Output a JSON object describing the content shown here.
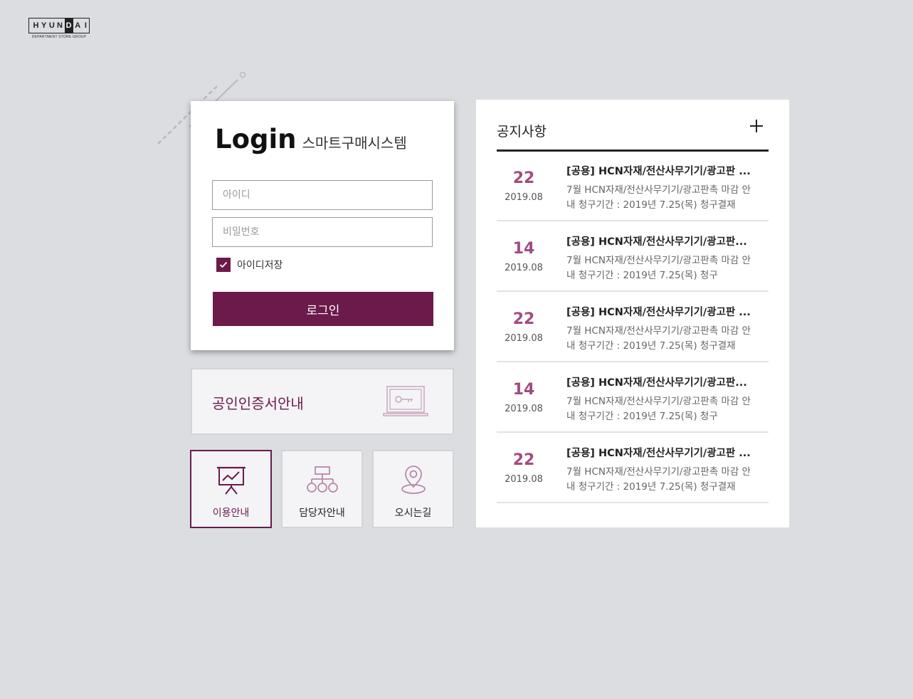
{
  "logo": {
    "letters": [
      "H",
      "Y",
      "U",
      "N",
      "D",
      "A",
      "I"
    ],
    "subtitle": "DEPARTMENT STORE GROUP"
  },
  "login": {
    "title": "Login",
    "subtitle": "스마트구매시스템",
    "id_placeholder": "아이디",
    "pw_placeholder": "비밀번호",
    "remember_label": "아이디저장",
    "remember_checked": true,
    "button_label": "로그인"
  },
  "cert": {
    "label": "공인인증서안내",
    "icon": "laptop-key-icon"
  },
  "tiles": [
    {
      "label": "이용안내",
      "icon": "presentation-chart-icon",
      "active": true
    },
    {
      "label": "담당자안내",
      "icon": "org-chart-icon",
      "active": false
    },
    {
      "label": "오시는길",
      "icon": "location-pin-icon",
      "active": false
    }
  ],
  "notice": {
    "title": "공지사항",
    "more_icon": "plus-icon",
    "items": [
      {
        "day": "22",
        "ym": "2019.08",
        "title": "[공용] HCN자재/전산사무기기/광고판 ...",
        "desc": "7월 HCN자재/전산사무기기/광고판촉 마감 안내 청구기간 : 2019년 7.25(목) 청구결재"
      },
      {
        "day": "14",
        "ym": "2019.08",
        "title": "[공용] HCN자재/전산사무기기/광고판...",
        "desc": "7월 HCN자재/전산사무기기/광고판촉 마감 안내 청구기간 : 2019년 7.25(목) 청구"
      },
      {
        "day": "22",
        "ym": "2019.08",
        "title": "[공용] HCN자재/전산사무기기/광고판 ...",
        "desc": "7월 HCN자재/전산사무기기/광고판촉 마감 안내 청구기간 : 2019년 7.25(목) 청구결재"
      },
      {
        "day": "14",
        "ym": "2019.08",
        "title": "[공용] HCN자재/전산사무기기/광고판...",
        "desc": "7월 HCN자재/전산사무기기/광고판촉 마감 안내 청구기간 : 2019년 7.25(목) 청구"
      },
      {
        "day": "22",
        "ym": "2019.08",
        "title": "[공용] HCN자재/전산사무기기/광고판 ...",
        "desc": "7월 HCN자재/전산사무기기/광고판촉 마감 안내 청구기간 : 2019년 7.25(목) 청구결재"
      }
    ]
  },
  "colors": {
    "brand": "#6b1a4a",
    "accent_date": "#a44b7f",
    "background": "#dcdde1"
  }
}
